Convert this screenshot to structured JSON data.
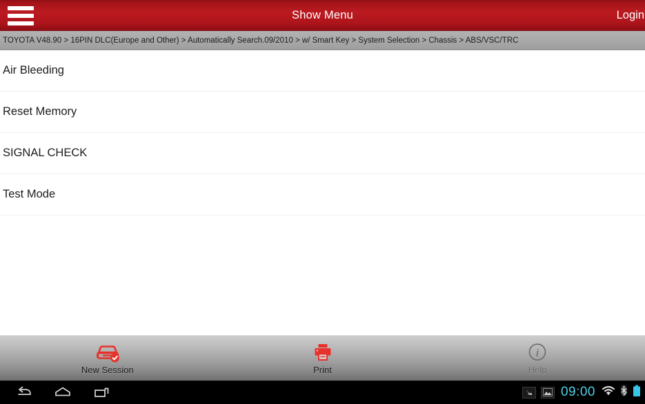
{
  "header": {
    "menu_icon": "hamburger-menu-icon",
    "title": "Show Menu",
    "login_label": "Login",
    "background_color": "#b0131a",
    "text_color": "#ffffff"
  },
  "breadcrumb": {
    "text": "TOYOTA V48.90 > 16PIN DLC(Europe and Other) > Automatically Search.09/2010 > w/ Smart Key > System Selection > Chassis > ABS/VSC/TRC",
    "background_color": "#a8a8a8"
  },
  "menu": {
    "items": [
      {
        "label": "Air Bleeding"
      },
      {
        "label": "Reset Memory"
      },
      {
        "label": "SIGNAL CHECK"
      },
      {
        "label": "Test Mode"
      }
    ]
  },
  "toolbar": {
    "buttons": [
      {
        "label": "New Session",
        "icon": "car-check-icon",
        "enabled": true,
        "color": "#e8312a"
      },
      {
        "label": "Print",
        "icon": "printer-icon",
        "enabled": true,
        "color": "#e8312a"
      },
      {
        "label": "Help",
        "icon": "info-circle-icon",
        "enabled": false,
        "color": "#6e6e6e"
      }
    ]
  },
  "navbar": {
    "back_icon": "back-arrow-icon",
    "home_icon": "home-icon",
    "recents_icon": "recent-apps-icon",
    "status_icons": [
      "screenshot-icon",
      "gallery-image-icon",
      "wifi-icon",
      "bluetooth-icon",
      "battery-icon"
    ],
    "clock": "09:00",
    "clock_color": "#4fd0e7",
    "battery_color": "#36c6e8"
  }
}
